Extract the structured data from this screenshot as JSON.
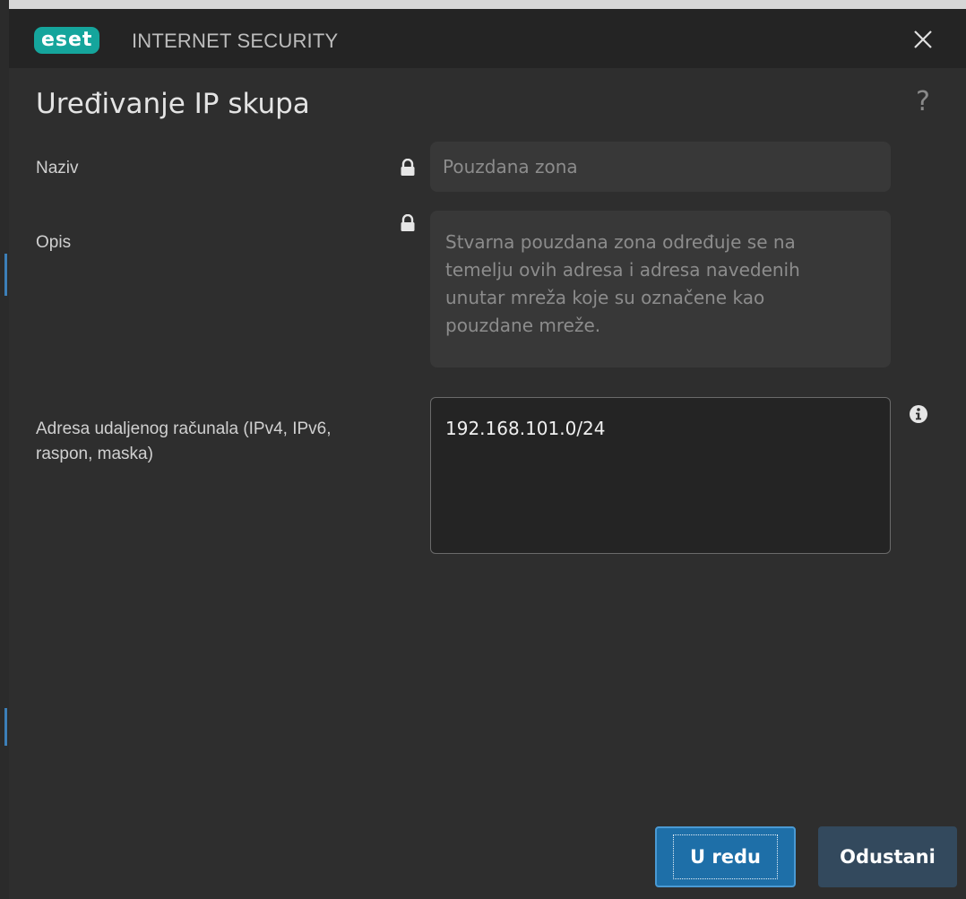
{
  "window": {
    "logo_text": "eset",
    "product_name": "INTERNET SECURITY",
    "close_icon": "close-icon",
    "brand_color": "#15a59c"
  },
  "dialog": {
    "title": "Uređivanje IP skupa",
    "help_glyph": "?"
  },
  "form": {
    "name_label": "Naziv",
    "name_value": "Pouzdana zona",
    "name_locked": true,
    "description_label": "Opis",
    "description_lines": [
      "Stvarna pouzdana zona određuje se na",
      "temelju ovih adresa i adresa navedenih",
      "unutar mreža koje su označene kao",
      "pouzdane mreže."
    ],
    "description_locked": true,
    "address_label_lines": [
      "Adresa udaljenog računala (IPv4, IPv6,",
      "raspon, maska)"
    ],
    "address_value": "192.168.101.0/24",
    "address_info_icon": "info-icon"
  },
  "buttons": {
    "ok_label": "U redu",
    "cancel_label": "Odustani",
    "ok_color": "#1e6fa8",
    "cancel_color": "#33495d"
  }
}
